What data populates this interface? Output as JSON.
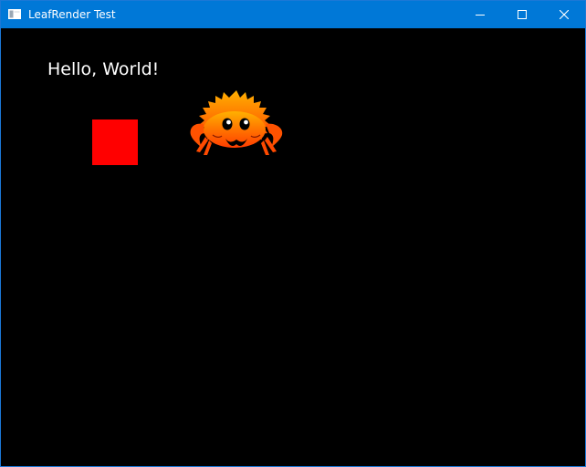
{
  "window": {
    "title": "LeafRender Test",
    "controls": {
      "minimize_icon": "minimize-icon",
      "maximize_icon": "maximize-icon",
      "close_icon": "close-icon"
    }
  },
  "canvas": {
    "greeting": "Hello, World!",
    "shapes": [
      {
        "kind": "square",
        "color": "#ff0000"
      }
    ],
    "sprite": {
      "name": "ferris-crab",
      "colors": [
        "#ffcc00",
        "#ff3c00",
        "#000000"
      ]
    }
  },
  "colors": {
    "titlebar": "#0078d7",
    "background": "#000000",
    "text": "#ffffff"
  }
}
